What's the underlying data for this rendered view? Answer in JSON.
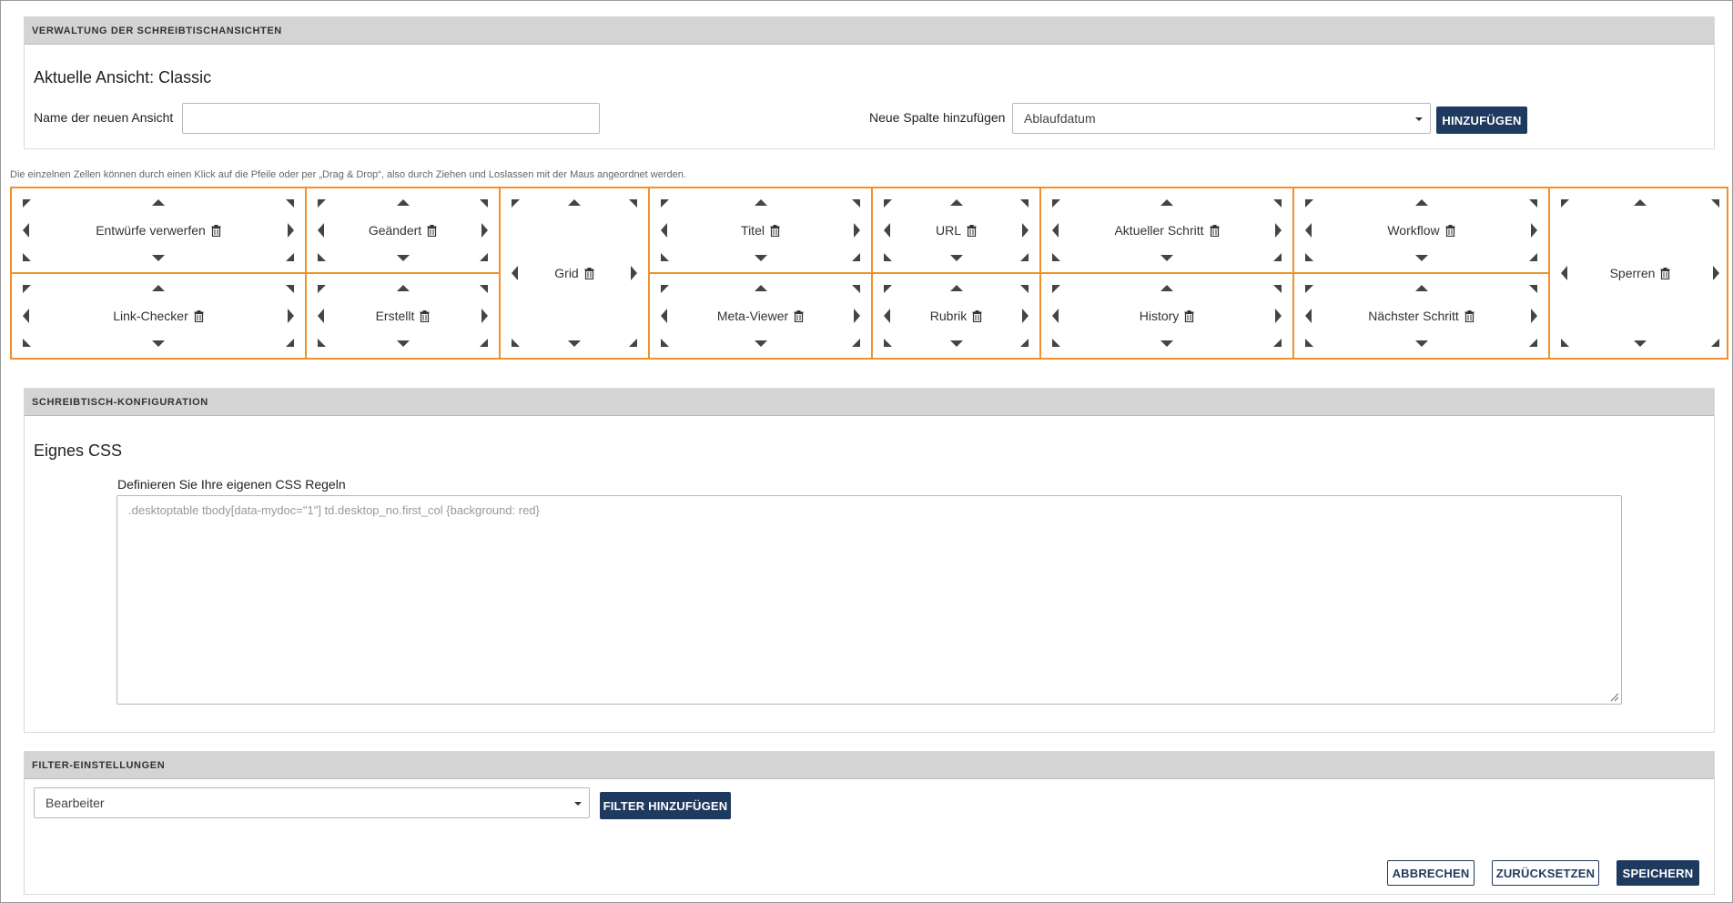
{
  "view_panel": {
    "header": "VERWALTUNG DER SCHREIBTISCHANSICHTEN",
    "current_view": "Aktuelle Ansicht: Classic",
    "new_view_label": "Name der neuen Ansicht",
    "new_view_value": "",
    "add_column_label": "Neue Spalte hinzufügen",
    "add_column_selected": "Ablaufdatum",
    "add_button": "HINZUFÜGEN"
  },
  "hint": "Die einzelnen Zellen können durch einen Klick auf die Pfeile oder per „Drag & Drop“, also durch Ziehen und Loslassen mit der Maus angeordnet werden.",
  "columns": [
    {
      "top": "Entwürfe verwerfen",
      "bottom": "Link-Checker"
    },
    {
      "top": "Geändert",
      "bottom": "Erstellt"
    },
    {
      "full": "Grid"
    },
    {
      "top": "Titel",
      "bottom": "Meta-Viewer"
    },
    {
      "top": "URL",
      "bottom": "Rubrik"
    },
    {
      "top": "Aktueller Schritt",
      "bottom": "History"
    },
    {
      "top": "Workflow",
      "bottom": "Nächster Schritt"
    },
    {
      "full": "Sperren"
    }
  ],
  "config_panel": {
    "header": "SCHREIBTISCH-KONFIGURATION",
    "title": "Eignes CSS",
    "css_label": "Definieren Sie Ihre eigenen CSS Regeln",
    "css_placeholder": ".desktoptable tbody[data-mydoc=\"1\"] td.desktop_no.first_col {background: red}"
  },
  "filter_panel": {
    "header": "FILTER-EINSTELLUNGEN",
    "filter_selected": "Bearbeiter",
    "add_filter_button": "FILTER HINZUFÜGEN"
  },
  "footer": {
    "cancel": "ABBRECHEN",
    "reset": "ZURÜCKSETZEN",
    "save": "SPEICHERN"
  },
  "colors": {
    "accent": "#1f3a5f",
    "grid_border": "#f0912b",
    "header_bg": "#d4d4d4"
  }
}
